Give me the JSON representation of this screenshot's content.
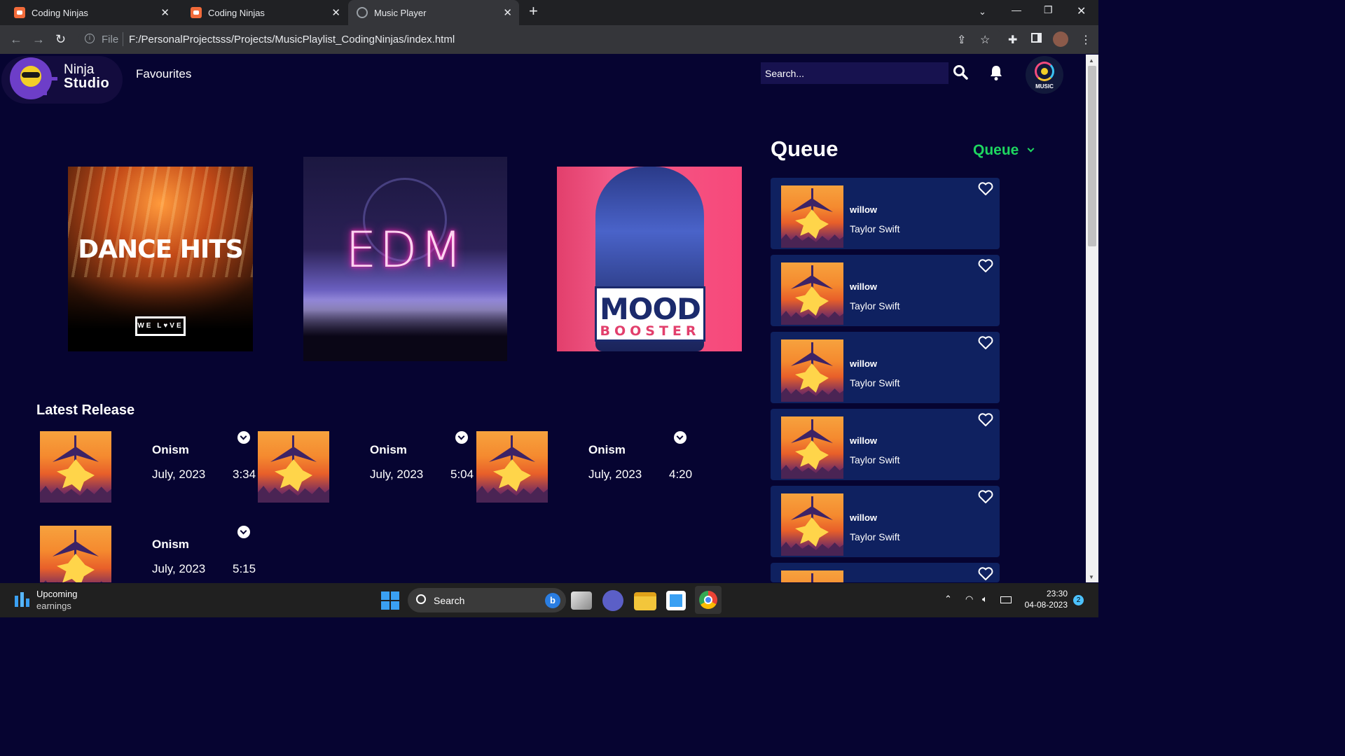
{
  "browser": {
    "tabs": [
      {
        "title": "Coding Ninjas"
      },
      {
        "title": "Coding Ninjas"
      },
      {
        "title": "Music Player"
      }
    ],
    "new_tab": "+",
    "address_scheme": "File",
    "url": "F:/PersonalProjectsss/Projects/MusicPlaylist_CodingNinjas/index.html"
  },
  "header": {
    "logo_line1": "Ninja",
    "logo_line2": "Studio",
    "nav_link": "Favourites",
    "search_placeholder": "Search...",
    "music_logo_text": "MUSIC"
  },
  "playlists": [
    {
      "title": "DANCE HITS",
      "badge": "WE L♥VE"
    },
    {
      "title": "EDM"
    },
    {
      "title": "MOOD",
      "subtitle": "BOOSTER"
    }
  ],
  "latest": {
    "heading": "Latest Release",
    "items": [
      {
        "name": "Onism",
        "date": "July, 2023",
        "duration": "3:34"
      },
      {
        "name": "Onism",
        "date": "July, 2023",
        "duration": "5:04"
      },
      {
        "name": "Onism",
        "date": "July, 2023",
        "duration": "4:20"
      },
      {
        "name": "Onism",
        "date": "July, 2023",
        "duration": "5:15"
      }
    ]
  },
  "queue": {
    "heading": "Queue",
    "selector": "Queue",
    "items": [
      {
        "song": "willow",
        "artist": "Taylor Swift"
      },
      {
        "song": "willow",
        "artist": "Taylor Swift"
      },
      {
        "song": "willow",
        "artist": "Taylor Swift"
      },
      {
        "song": "willow",
        "artist": "Taylor Swift"
      },
      {
        "song": "willow",
        "artist": "Taylor Swift"
      },
      {
        "song": "",
        "artist": ""
      }
    ]
  },
  "taskbar": {
    "widget_title": "Upcoming",
    "widget_sub": "earnings",
    "search_label": "Search",
    "time": "23:30",
    "date": "04-08-2023",
    "notifications": "2"
  },
  "colors": {
    "page_bg": "#060431",
    "queue_card": "#0f2160",
    "accent_green": "#1ed760"
  }
}
